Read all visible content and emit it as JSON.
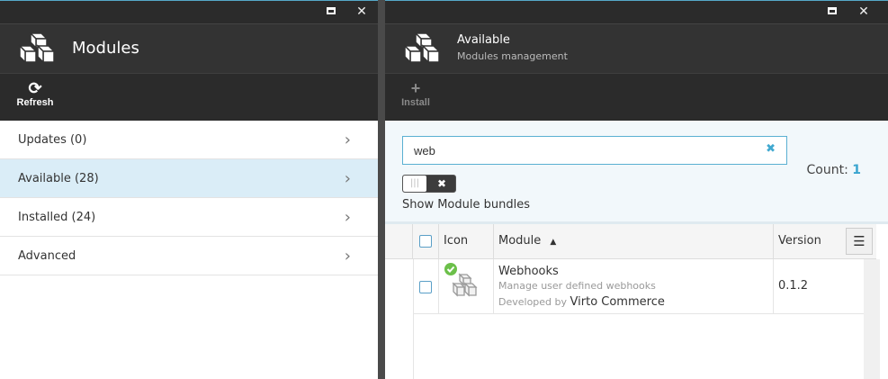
{
  "left_blade": {
    "title": "Modules",
    "toolbar": {
      "refresh_label": "Refresh"
    },
    "nav": [
      {
        "label": "Updates (0)"
      },
      {
        "label": "Available (28)",
        "active": true
      },
      {
        "label": "Installed (24)"
      },
      {
        "label": "Advanced"
      }
    ]
  },
  "right_blade": {
    "title": "Available",
    "subtitle": "Modules management",
    "toolbar": {
      "install_label": "Install"
    },
    "search": {
      "value": "web"
    },
    "toggle_label": "Show Module bundles",
    "count": {
      "label": "Count:",
      "value": "1"
    },
    "grid": {
      "headers": {
        "icon": "Icon",
        "module": "Module",
        "version": "Version"
      },
      "rows": [
        {
          "name": "Webhooks",
          "description": "Manage user defined webhooks",
          "developed_by_label": "Developed by",
          "developer": "Virto Commerce",
          "version": "0.1.2"
        }
      ]
    }
  },
  "colors": {
    "accent": "#3aa5cf",
    "active_row": "#daedf7",
    "header_bg": "#333333",
    "installed_badge": "#6cc04a"
  }
}
